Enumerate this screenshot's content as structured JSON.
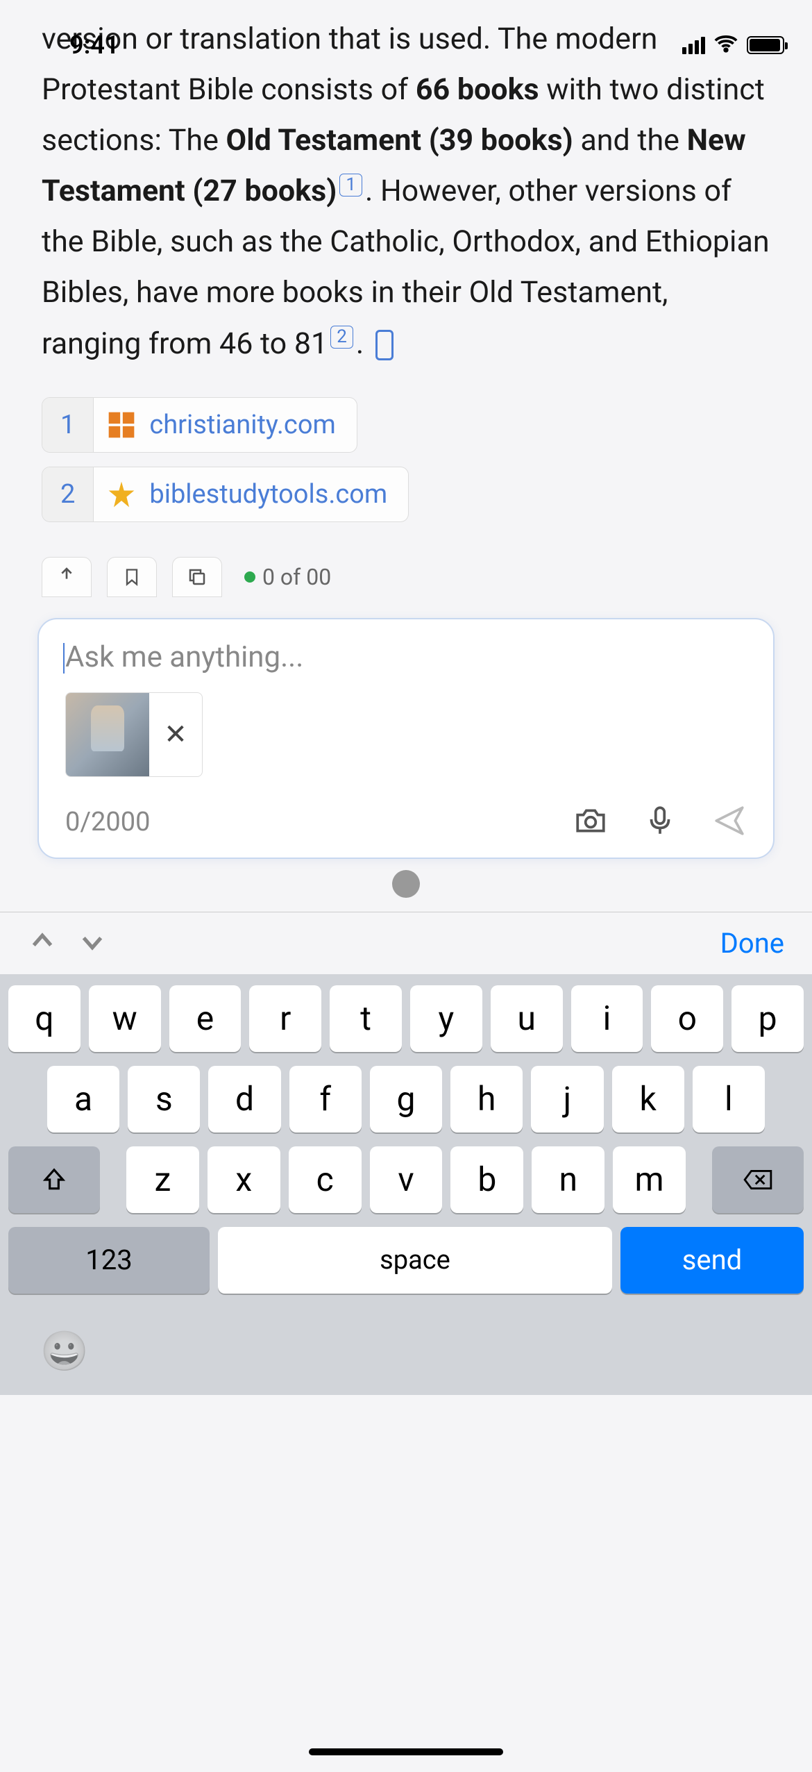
{
  "status": {
    "time": "9:41"
  },
  "content": {
    "part1": "version or translation that is used. The modern Protestant Bible consists of ",
    "bold1": "66 books",
    "part2": " with two distinct sections: The ",
    "bold2": "Old Testament (39 books)",
    "part3": " and the ",
    "bold3": "New Testament (27 books)",
    "cite1": "1",
    "part4": ". However, other versions of the Bible, such as the Catholic, Orthodox, and Ethiopian Bibles, have more books in their Old Testament, ranging from 46 to 81",
    "cite2": "2",
    "part5": "."
  },
  "sources": [
    {
      "num": "1",
      "text": "christianity.com",
      "icon_color": "#e67e22"
    },
    {
      "num": "2",
      "text": "biblestudytools.com",
      "icon_color": "#f0b020"
    }
  ],
  "pagination": {
    "text": "0 of 00"
  },
  "input": {
    "placeholder": "Ask me anything...",
    "char_count": "0/2000"
  },
  "keyboard": {
    "done": "Done",
    "row1": [
      "q",
      "w",
      "e",
      "r",
      "t",
      "y",
      "u",
      "i",
      "o",
      "p"
    ],
    "row2": [
      "a",
      "s",
      "d",
      "f",
      "g",
      "h",
      "j",
      "k",
      "l"
    ],
    "row3": [
      "z",
      "x",
      "c",
      "v",
      "b",
      "n",
      "m"
    ],
    "num_label": "123",
    "space_label": "space",
    "send_label": "send"
  }
}
